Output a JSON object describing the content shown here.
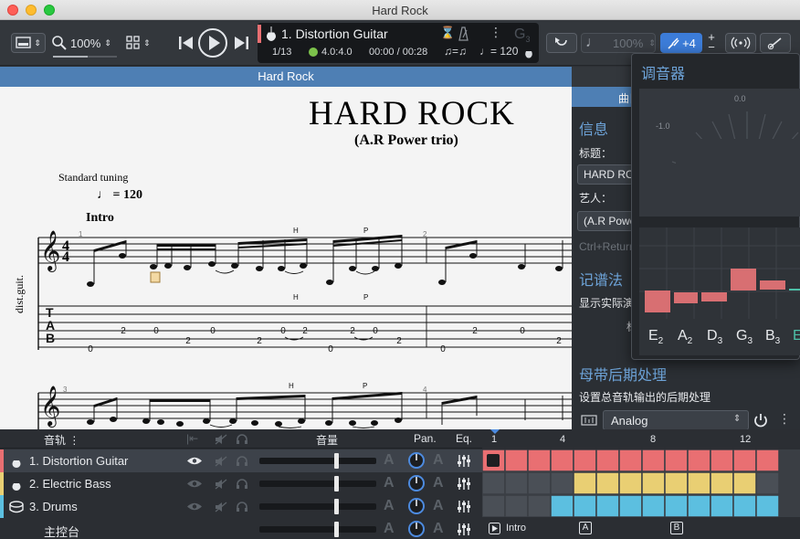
{
  "window": {
    "title": "Hard Rock"
  },
  "toolbar": {
    "zoom": "100%",
    "track_name": "1. Distortion Guitar",
    "position": "1/13",
    "time_sig": "4.0:4.0",
    "time": "00:00 / 00:28",
    "tempo": "= 120",
    "key_hint": "G",
    "key_sub": "3",
    "speed": "100%",
    "transpose": "+4"
  },
  "banner": {
    "title": "Hard Rock"
  },
  "score": {
    "title": "HARD ROCK",
    "subtitle": "(A.R Power trio)",
    "tuning": "Standard tuning",
    "tempo": "= 120",
    "section": "Intro",
    "instrument": "dist.guit.",
    "time_sig_top": "4",
    "time_sig_bottom": "4",
    "tab_letters": [
      "T",
      "A",
      "B"
    ],
    "bar_numbers": [
      "1",
      "2",
      "3",
      "4"
    ],
    "hammer": "H",
    "pull": "P"
  },
  "panel": {
    "tab_label": "曲目",
    "info_heading": "信息",
    "title_label": "标题：",
    "title_value": "HARD ROCK",
    "artist_label": "艺人：",
    "artist_value": "(A.R Power trio)",
    "shortcut_hint": "Ctrl+Return",
    "notation_heading": "记谱法",
    "notation_item": "显示实际演奏音高",
    "notation_sub": "标",
    "master_heading": "母带后期处理",
    "master_desc": "设置总音轨输出的后期处理",
    "preset": "Analog"
  },
  "tuner": {
    "title": "调音器",
    "cents_left": "-1.0",
    "cents_center": "0.0",
    "strings": [
      {
        "note": "E",
        "oct": "2"
      },
      {
        "note": "A",
        "oct": "2"
      },
      {
        "note": "D",
        "oct": "3"
      },
      {
        "note": "G",
        "oct": "3"
      },
      {
        "note": "B",
        "oct": "3"
      },
      {
        "note": "E",
        "oct": ""
      }
    ]
  },
  "tracks": {
    "header_track": "音轨",
    "header_volume": "音量",
    "header_pan": "Pan.",
    "header_eq": "Eq.",
    "items": [
      {
        "label": "1. Distortion Guitar",
        "color": "#e96f72"
      },
      {
        "label": "2. Electric Bass",
        "color": "#e9cf73"
      },
      {
        "label": "3. Drums",
        "color": "#5cbfe0"
      },
      {
        "label": "主控台",
        "color": ""
      }
    ],
    "ruler": [
      "1",
      "4",
      "8",
      "12"
    ],
    "markers": [
      "Intro",
      "A",
      "B"
    ]
  }
}
